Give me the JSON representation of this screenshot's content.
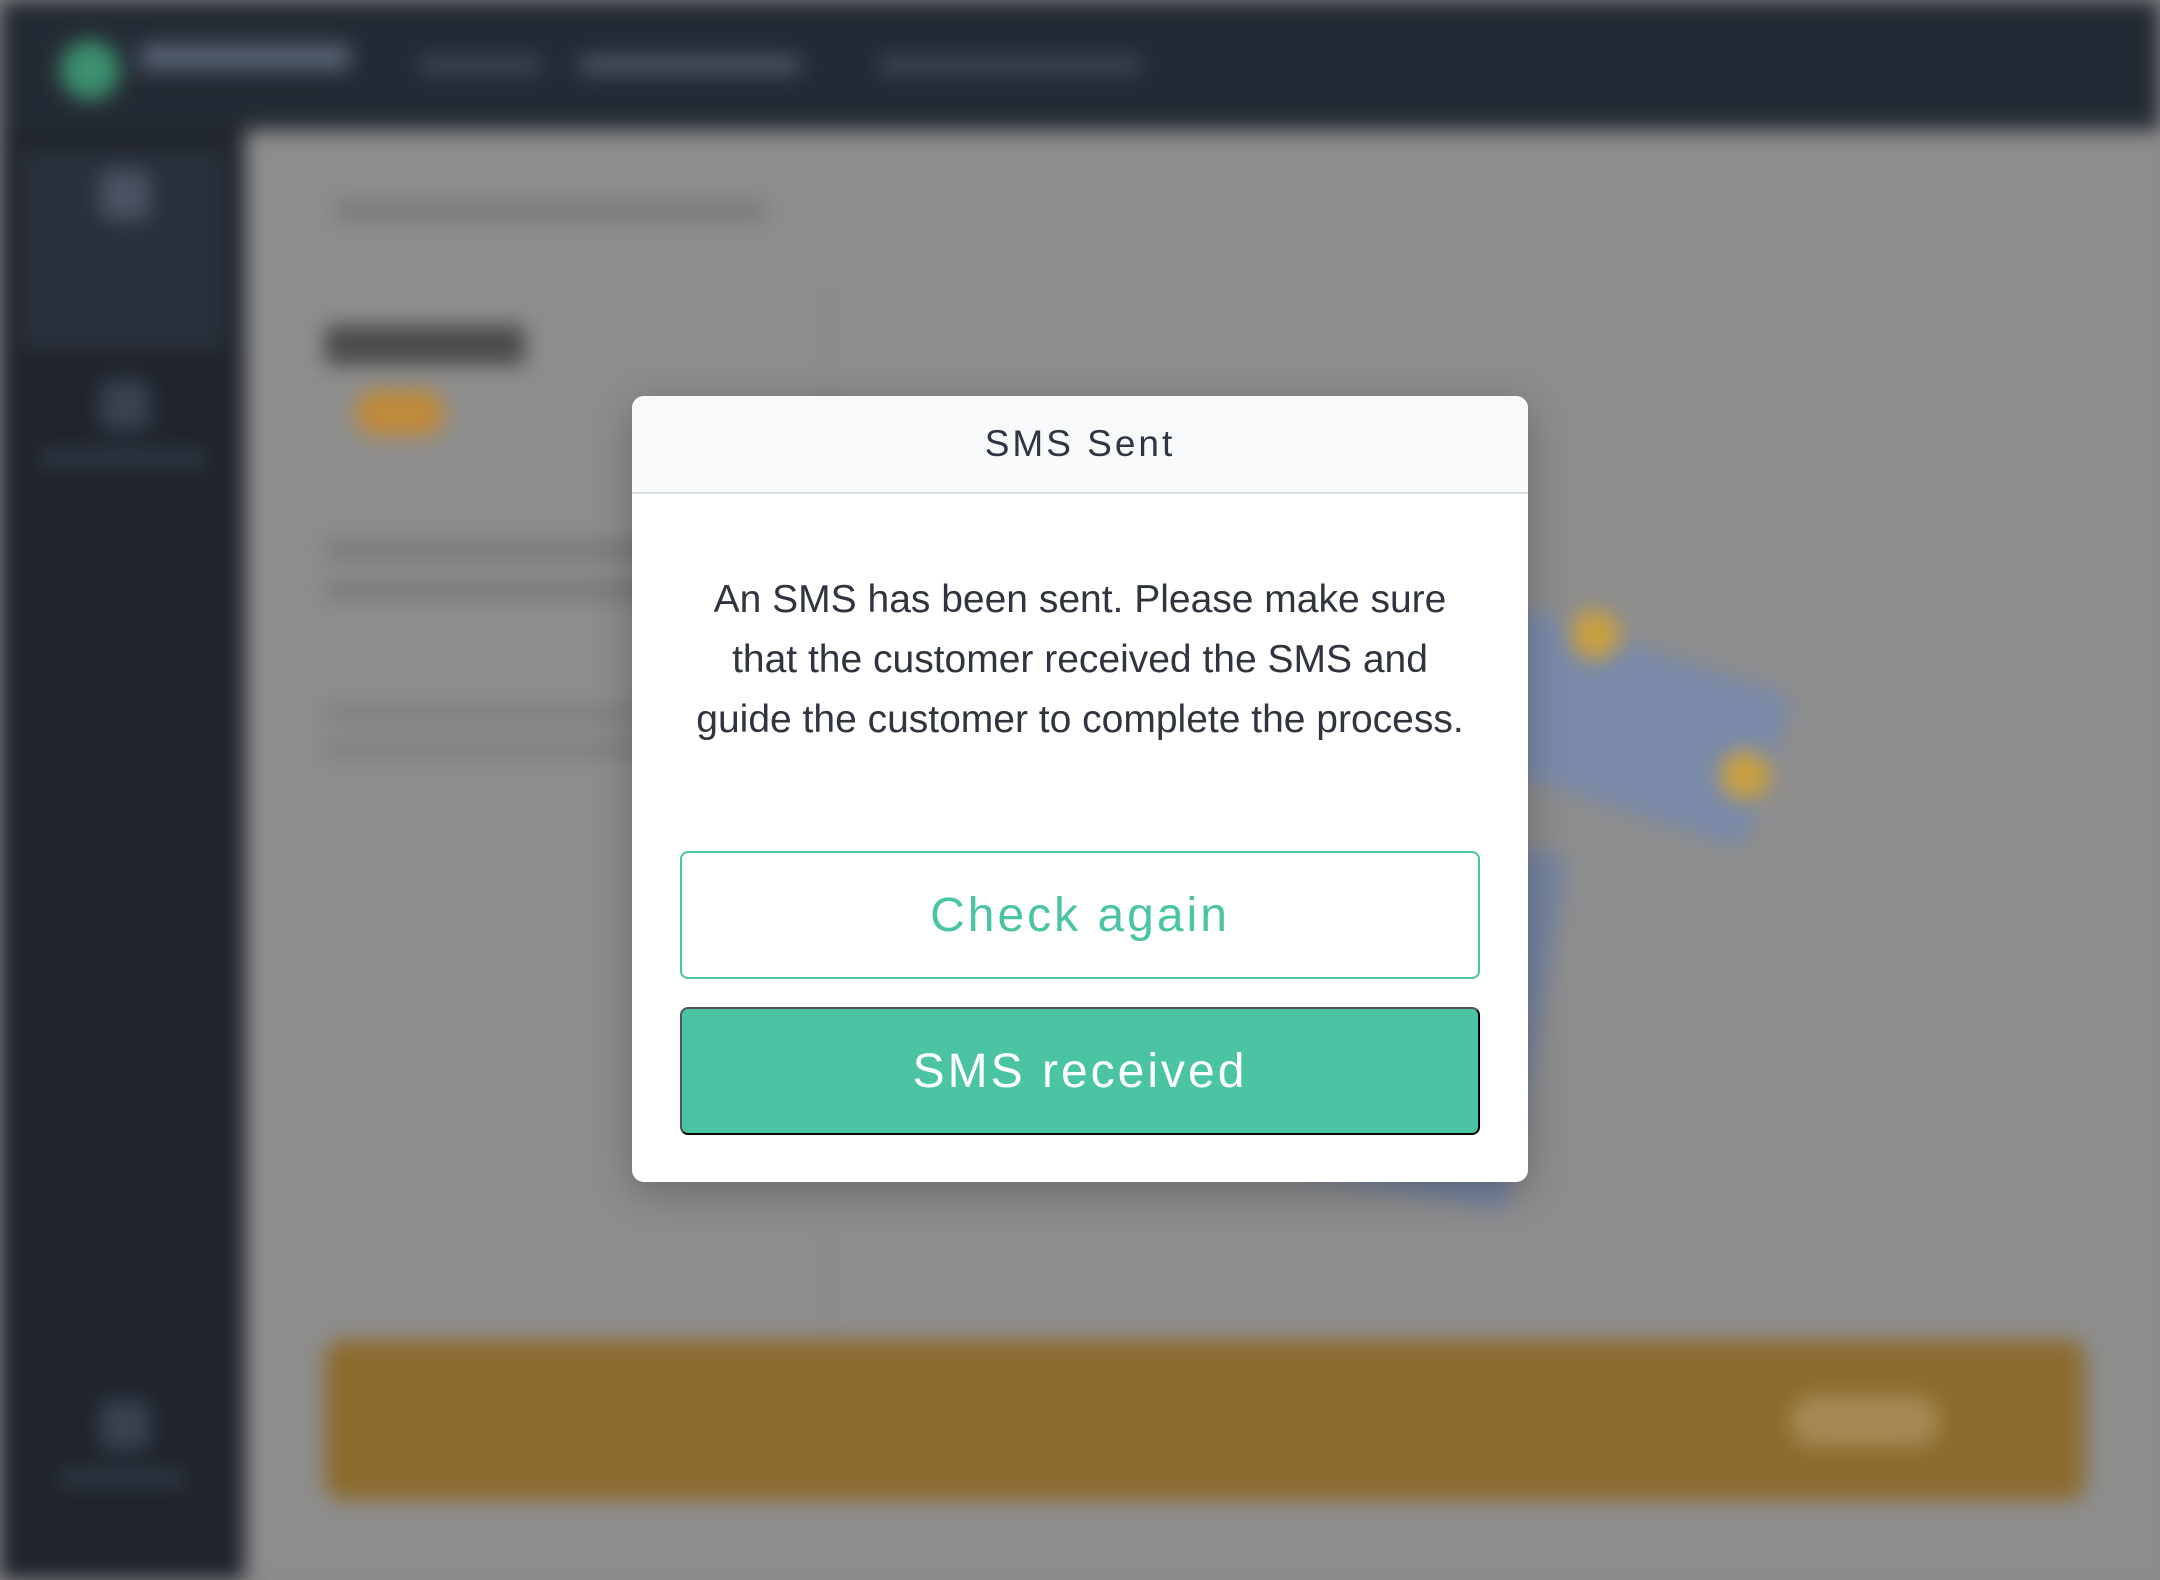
{
  "dialog": {
    "title": "SMS Sent",
    "message": "An SMS has been sent. Please make sure that the customer received the SMS and guide the customer to complete the process.",
    "secondary_button": "Check again",
    "primary_button": "SMS received"
  },
  "colors": {
    "accent": "#4bc4a4",
    "overlay": "#8a8a8a",
    "topbar": "#242a33",
    "sidebar": "#1f242c",
    "banner": "#8c6b2e"
  }
}
